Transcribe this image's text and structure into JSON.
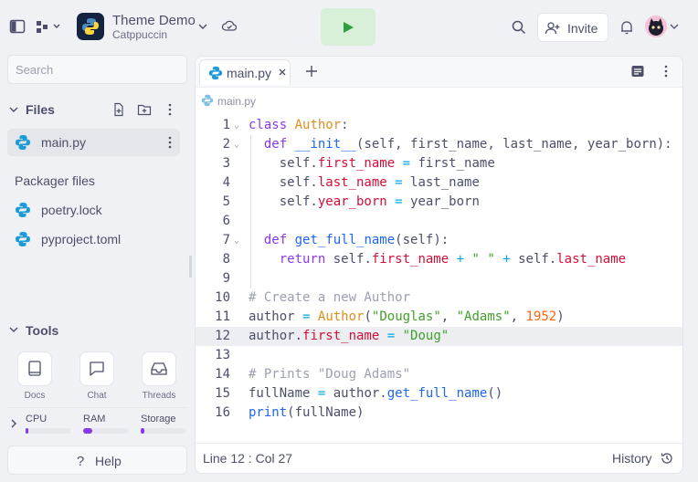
{
  "header": {
    "project_title": "Theme Demo",
    "project_subtitle": "Catppuccin",
    "invite_label": "Invite",
    "run_color": "#2f9e44"
  },
  "sidebar": {
    "search_placeholder": "Search",
    "files_heading": "Files",
    "files": [
      {
        "name": "main.py"
      }
    ],
    "packager_heading": "Packager files",
    "packager_files": [
      {
        "name": "poetry.lock"
      },
      {
        "name": "pyproject.toml"
      }
    ],
    "tools_heading": "Tools",
    "tools": [
      {
        "label": "Docs",
        "icon": "book-icon"
      },
      {
        "label": "Chat",
        "icon": "chat-icon"
      },
      {
        "label": "Threads",
        "icon": "inbox-icon"
      }
    ],
    "resources": [
      {
        "label": "CPU",
        "usage": 0.04
      },
      {
        "label": "RAM",
        "usage": 0.2
      },
      {
        "label": "Storage",
        "usage": 0.08
      }
    ],
    "help_label": "Help"
  },
  "editor": {
    "tab_label": "main.py",
    "breadcrumb": "main.py",
    "active_line": 12,
    "code_lines": [
      "class Author:",
      "  def __init__(self, first_name, last_name, year_born):",
      "    self.first_name = first_name",
      "    self.last_name = last_name",
      "    self.year_born = year_born",
      "",
      "  def get_full_name(self):",
      "    return self.first_name + \" \" + self.last_name",
      "",
      "# Create a new Author",
      "author = Author(\"Douglas\", \"Adams\", 1952)",
      "author.first_name = \"Doug\"",
      "",
      "# Prints \"Doug Adams\"",
      "fullName = author.get_full_name()",
      "print(fullName)"
    ],
    "status_position": "Line 12 : Col 27",
    "history_label": "History"
  },
  "colors": {
    "accent": "#8839ef",
    "keyword": "#8839ef",
    "class_name": "#df8e1d",
    "function": "#1e66f5",
    "attribute": "#d20f39",
    "string": "#40a02b",
    "number": "#fe640b",
    "comment": "#9ca0b0"
  }
}
